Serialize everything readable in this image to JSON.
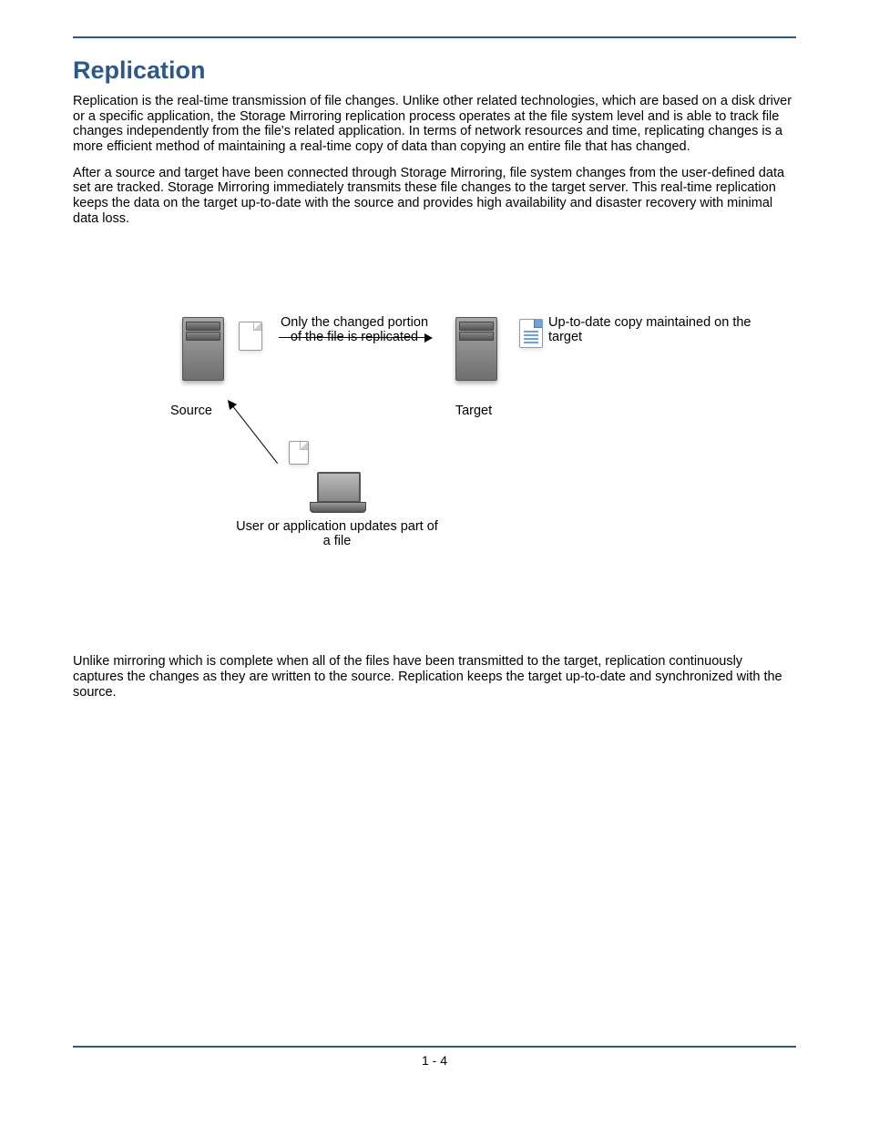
{
  "title": "Replication",
  "para1": "Replication is the real-time transmission of file changes. Unlike other related technologies, which are based on a disk driver or a specific application, the Storage Mirroring replication process operates at the file system level and is able to track file changes independently from the file's related application. In terms of network resources and time, replicating changes is a more efficient method of maintaining a real-time copy of data than copying an entire file that has changed.",
  "para2": "After a source and target have been connected through Storage Mirroring, file system changes from the user-defined data set are tracked.  Storage Mirroring immediately transmits these file changes to the target server. This real-time replication keeps the data on the target up-to-date with the source and provides high availability and disaster recovery with minimal data loss.",
  "diagram": {
    "source_label": "Source",
    "target_label": "Target",
    "arrow_label": "Only the changed portion of the file is replicated",
    "target_note": "Up-to-date copy maintained on the target",
    "user_label": "User or application updates part of a file"
  },
  "para3": "Unlike mirroring which is complete when all of the files have been transmitted to the target, replication continuously captures the changes as they are written to the source. Replication keeps the target up-to-date and synchronized with the source.",
  "page_number": "1 - 4"
}
